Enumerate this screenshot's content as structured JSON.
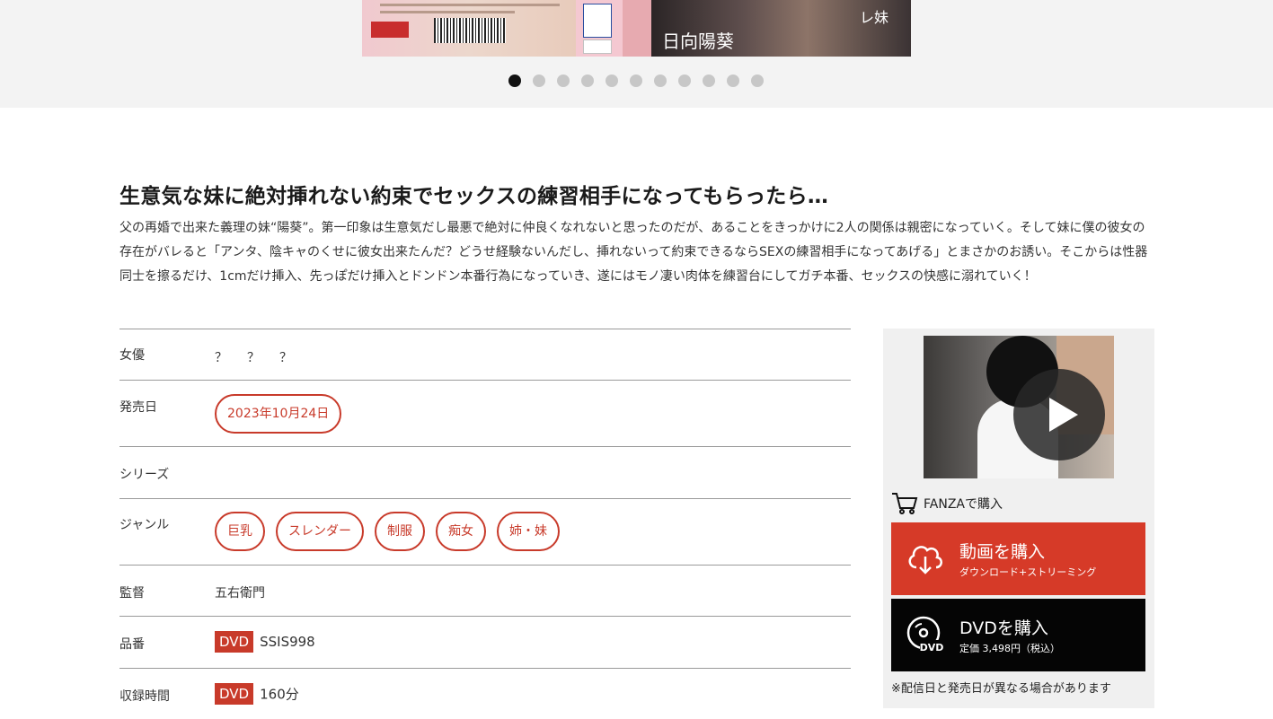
{
  "cover": {
    "name_text": "日向陽葵",
    "sub_text": "レ妹"
  },
  "slider": {
    "dot_count": 11,
    "active_index": 0
  },
  "title": "生意気な妹に絶対挿れない約束でセックスの練習相手になってもらったら…",
  "description": "父の再婚で出来た義理の妹“陽葵”。第一印象は生意気だし最悪で絶対に仲良くなれないと思ったのだが、あることをきっかけに2人の関係は親密になっていく。そして妹に僕の彼女の存在がバレると「アンタ、陰キャのくせに彼女出来たんだ？どうせ経験ないんだし、挿れないって約束できるならSEXの練習相手になってあげる」とまさかのお誘い。そこからは性器同士を擦るだけ、1cmだけ挿入、先っぽだけ挿入とドンドン本番行為になっていき、遂にはモノ凄い肉体を練習台にしてガチ本番、セックスの快感に溺れていく！",
  "info": {
    "actress_label": "女優",
    "actress_value": "？？？",
    "release_label": "発売日",
    "release_value": "2023年10月24日",
    "series_label": "シリーズ",
    "series_value": "",
    "genre_label": "ジャンル",
    "genres": [
      "巨乳",
      "スレンダー",
      "制服",
      "痴女",
      "姉・妹"
    ],
    "director_label": "監督",
    "director_value": "五右衛門",
    "product_label": "品番",
    "product_tag": "DVD",
    "product_value": "SSIS998",
    "duration_label": "収録時間",
    "duration_tag": "DVD",
    "duration_value": "160分"
  },
  "sidebar": {
    "fanza_label": "FANZAで購入",
    "video_buy_label": "動画を購入",
    "video_buy_sub": "ダウンロード+ストリーミング",
    "dvd_buy_label": "DVDを購入",
    "dvd_buy_sub": "定価 3,498円（税込）",
    "dvd_icon_text": "DVD",
    "note": "※配信日と発売日が異なる場合があります"
  },
  "colors": {
    "accent_red": "#c83a2a",
    "button_red": "#d63a28",
    "button_black": "#050505"
  }
}
